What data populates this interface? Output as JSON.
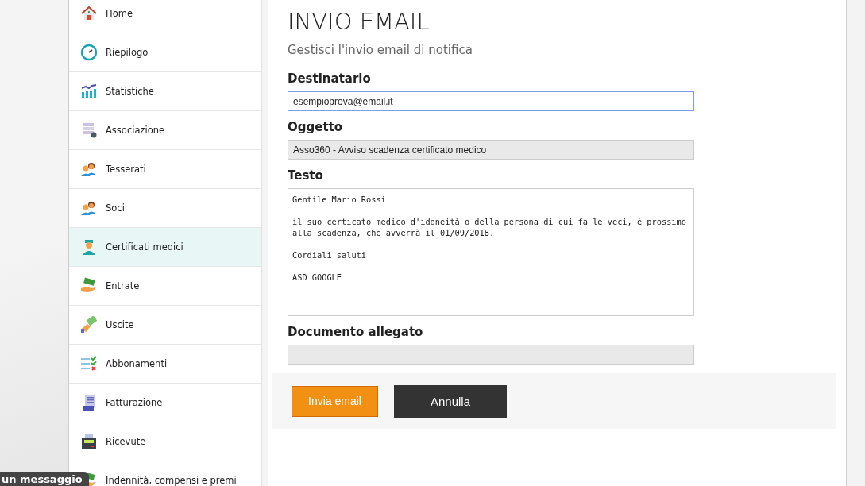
{
  "sidebar": {
    "items": [
      {
        "label": "Home",
        "selected": false
      },
      {
        "label": "Riepilogo",
        "selected": false
      },
      {
        "label": "Statistiche",
        "selected": false
      },
      {
        "label": "Associazione",
        "selected": false
      },
      {
        "label": "Tesserati",
        "selected": false
      },
      {
        "label": "Soci",
        "selected": false
      },
      {
        "label": "Certificati medici",
        "selected": true
      },
      {
        "label": "Entrate",
        "selected": false
      },
      {
        "label": "Uscite",
        "selected": false
      },
      {
        "label": "Abbonamenti",
        "selected": false
      },
      {
        "label": "Fatturazione",
        "selected": false
      },
      {
        "label": "Ricevute",
        "selected": false
      },
      {
        "label": "Indennità, compensi e premi",
        "selected": false
      }
    ]
  },
  "page": {
    "title": "INVIO EMAIL",
    "subtitle": "Gestisci l'invio email di notifica"
  },
  "form": {
    "fields": [
      {
        "kind": "input",
        "label": "Destinatario",
        "value": "esempioprova@email.it",
        "focused": true,
        "disabled": false
      },
      {
        "kind": "input",
        "label": "Oggetto",
        "value": "Asso360 - Avviso scadenza certificato medico",
        "focused": false,
        "disabled": true
      },
      {
        "kind": "textarea",
        "label": "Testo",
        "value": "Gentile Mario Rossi\n\nil suo certicato medico d'idoneità o della persona di cui fa le veci, è prossimo alla scadenza, che avverrà il 01/09/2018.\n\nCordiali saluti\n\nASD GOOGLE",
        "focused": false,
        "disabled": false
      },
      {
        "kind": "input",
        "label": "Documento allegato",
        "focused": false,
        "disabled": true
      }
    ]
  },
  "buttons": [
    {
      "label": "Invia email",
      "kind": "primary"
    },
    {
      "label": "Annulla",
      "kind": "secondary"
    }
  ],
  "chat_tab": {
    "label": "un messaggio"
  }
}
